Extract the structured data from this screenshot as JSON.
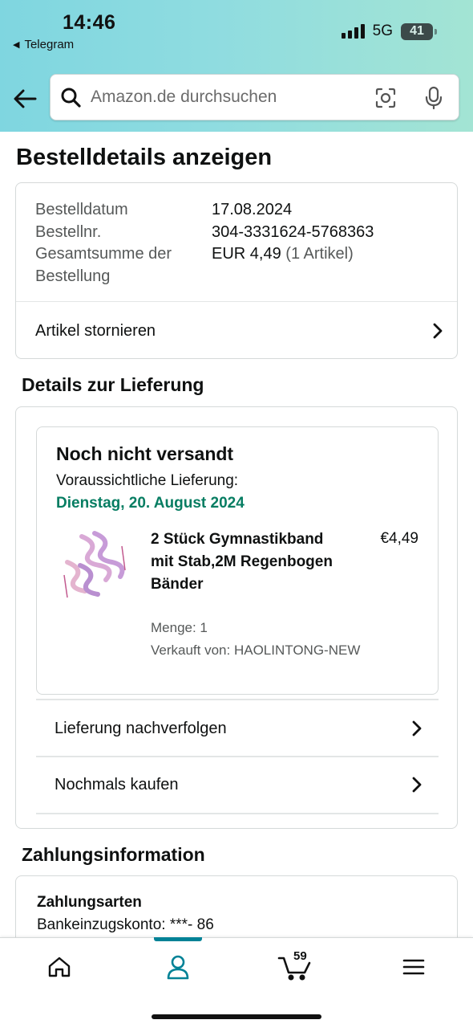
{
  "status_bar": {
    "time": "14:46",
    "back_app": "Telegram",
    "network": "5G",
    "battery": "41"
  },
  "search": {
    "placeholder": "Amazon.de durchsuchen"
  },
  "page": {
    "title": "Bestelldetails anzeigen"
  },
  "order_summary": {
    "date_label": "Bestelldatum",
    "date_value": "17.08.2024",
    "number_label": "Bestellnr.",
    "number_value": "304-3331624-5768363",
    "total_label_line1": "Gesamtsumme der",
    "total_label_line2": "Bestellung",
    "total_value": "EUR 4,49",
    "total_items": "(1 Artikel)",
    "cancel_link": "Artikel stornieren"
  },
  "delivery": {
    "section_title": "Details zur Lieferung",
    "status": "Noch nicht versandt",
    "eta_label": "Voraussichtliche Lieferung:",
    "eta_date": "Dienstag, 20. August 2024",
    "product": {
      "title": "2 Stück Gymnastikband mit Stab,2M Regenbogen Bänder",
      "price": "€4,49",
      "quantity": "Menge: 1",
      "seller": "Verkauft von: HAOLINTONG-NEW"
    },
    "track_link": "Lieferung nachverfolgen",
    "buy_again_link": "Nochmals kaufen"
  },
  "payment": {
    "section_title": "Zahlungsinformation",
    "methods_label": "Zahlungsarten",
    "method_value": "Bankeinzugskonto: ***- 86"
  },
  "tabbar": {
    "cart_count": "59",
    "active_tab": "account",
    "accent_color": "#008296"
  },
  "colors": {
    "eta_green": "#067d62",
    "header_gradient_start": "#7fd6e0",
    "header_gradient_end": "#a3e4d4"
  }
}
